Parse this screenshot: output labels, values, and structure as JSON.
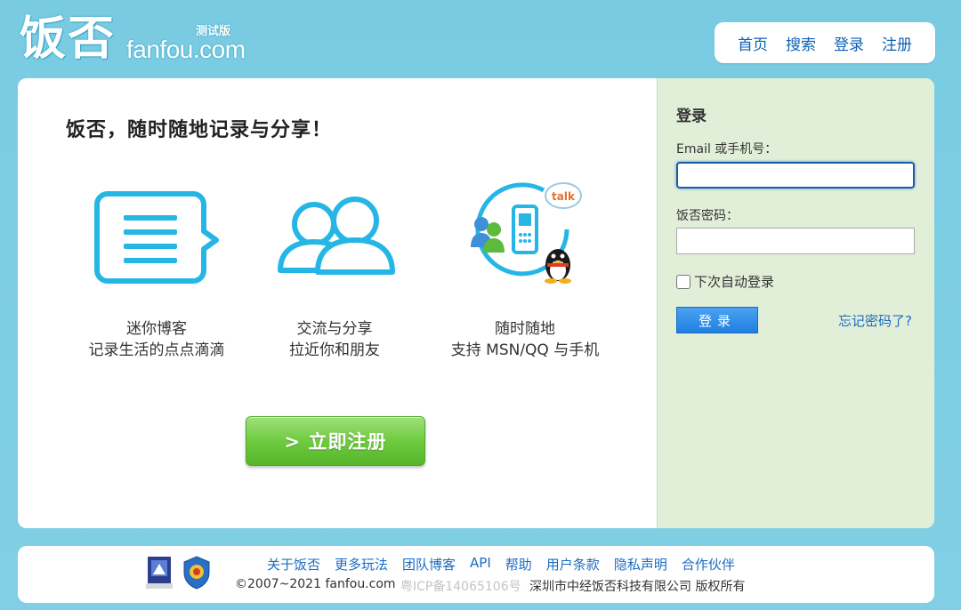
{
  "header": {
    "logo_cn": "饭否",
    "logo_en": "fanfou.com",
    "logo_beta": "测试版",
    "nav": [
      "首页",
      "搜索",
      "登录",
      "注册"
    ]
  },
  "main": {
    "slogan": "饭否，随时随地记录与分享！",
    "features": [
      {
        "icon": "speech-bubble-icon",
        "line1": "迷你博客",
        "line2": "记录生活的点点滴滴"
      },
      {
        "icon": "people-icon",
        "line1": "交流与分享",
        "line2": "拉近你和朋友"
      },
      {
        "icon": "mobile-im-icon",
        "line1": "随时随地",
        "line2": "支持 MSN/QQ 与手机"
      }
    ],
    "register_button": "> 立即注册"
  },
  "login": {
    "title": "登录",
    "email_label": "Email 或手机号：",
    "email_value": "",
    "password_label": "饭否密码：",
    "password_value": "",
    "remember_label": "下次自动登录",
    "remember_checked": false,
    "submit_label": "登录",
    "forgot_label": "忘记密码了?"
  },
  "footer": {
    "links": [
      "关于饭否",
      "更多玩法",
      "团队博客",
      "API",
      "帮助",
      "用户条款",
      "隐私声明",
      "合作伙伴"
    ],
    "copyright": "©2007~2021 fanfou.com",
    "icp": "粤ICP备14065106号",
    "company": "深圳市中经饭否科技有限公司 版权所有"
  },
  "colors": {
    "background": "#7dcde3",
    "link": "#1a6cc2",
    "icon_blue": "#26b6e6",
    "sidebar": "#e2efd8",
    "register_green": "#6fcb3f",
    "login_blue": "#1f7fe0"
  }
}
